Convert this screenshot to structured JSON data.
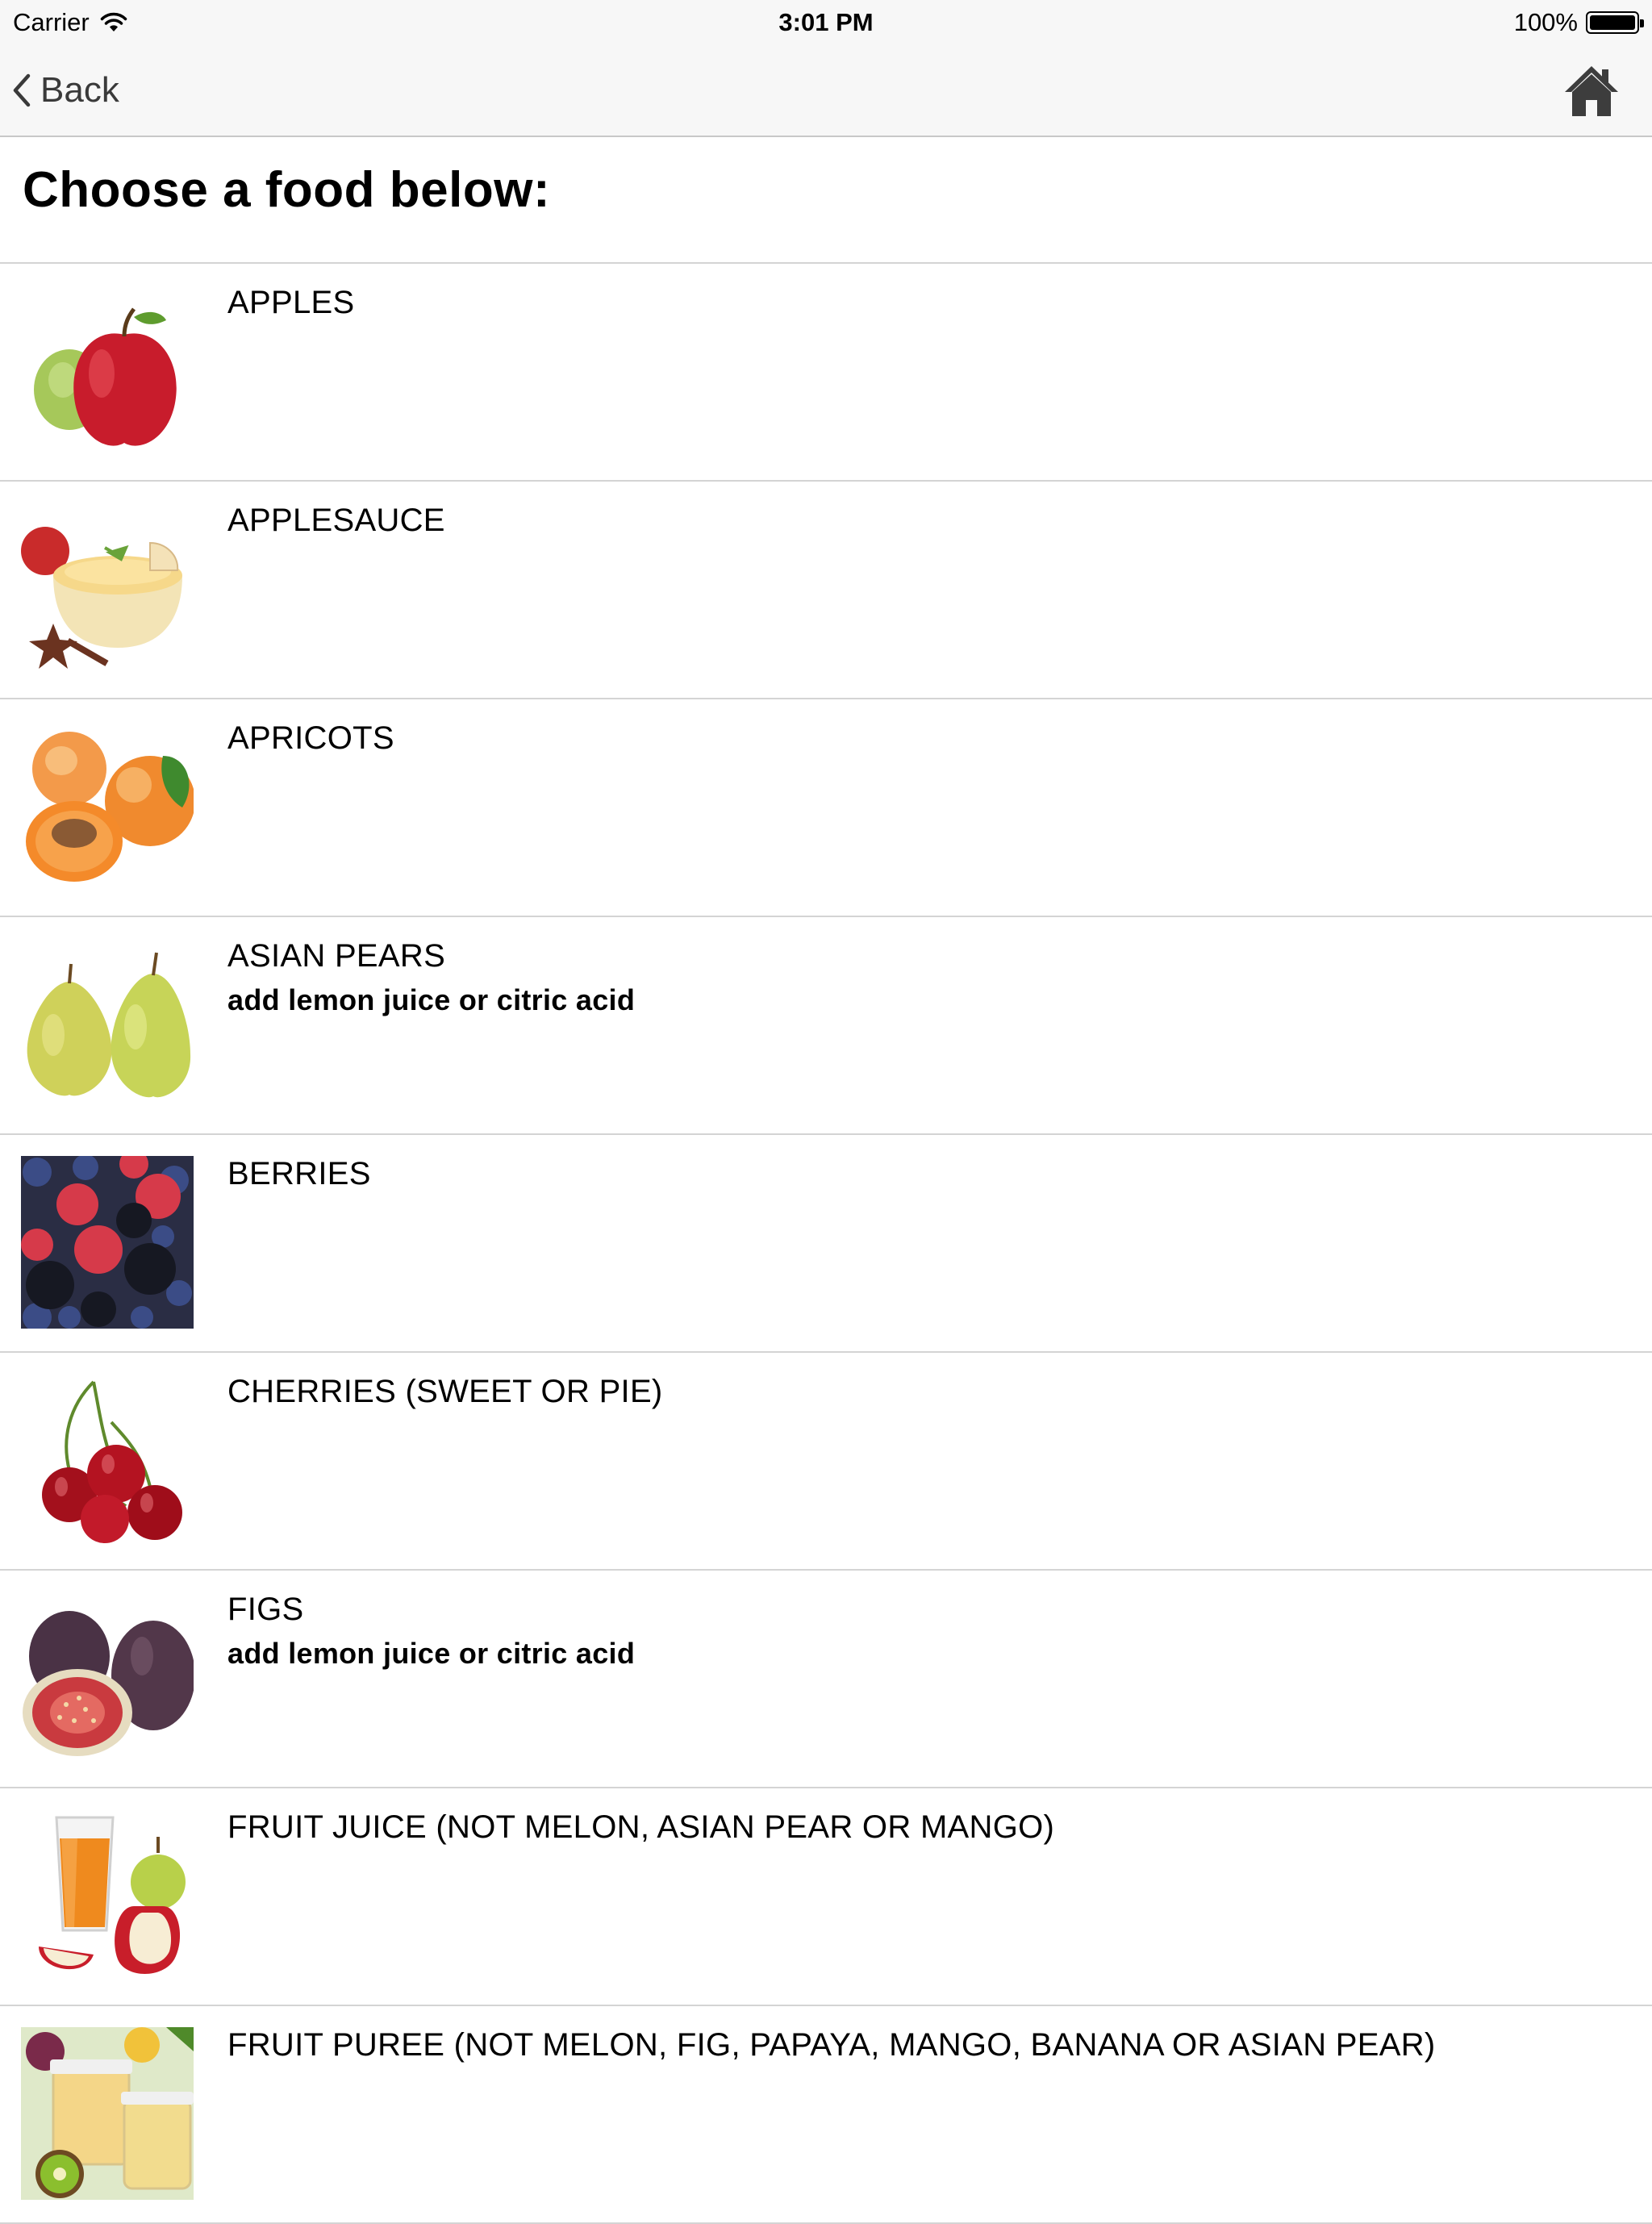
{
  "status": {
    "carrier": "Carrier",
    "time": "3:01 PM",
    "battery_percent": "100%",
    "battery_level": 1.0
  },
  "nav": {
    "back_label": "Back",
    "home_icon": "home-icon"
  },
  "page": {
    "title": "Choose a food below:"
  },
  "foods": [
    {
      "name": "APPLES",
      "note": "",
      "image": "apples-image"
    },
    {
      "name": "APPLESAUCE",
      "note": "",
      "image": "applesauce-image"
    },
    {
      "name": "APRICOTS",
      "note": "",
      "image": "apricots-image"
    },
    {
      "name": "ASIAN PEARS",
      "note": "add lemon juice or citric acid",
      "image": "asian-pears-image"
    },
    {
      "name": "BERRIES",
      "note": "",
      "image": "berries-image"
    },
    {
      "name": "CHERRIES (SWEET OR PIE)",
      "note": "",
      "image": "cherries-image"
    },
    {
      "name": "FIGS",
      "note": "add lemon juice or citric acid",
      "image": "figs-image"
    },
    {
      "name": "FRUIT JUICE (NOT MELON, ASIAN PEAR OR MANGO)",
      "note": "",
      "image": "fruit-juice-image"
    },
    {
      "name": "FRUIT PUREE (NOT MELON, FIG, PAPAYA, MANGO, BANANA OR ASIAN PEAR)",
      "note": "",
      "image": "fruit-puree-image"
    }
  ]
}
